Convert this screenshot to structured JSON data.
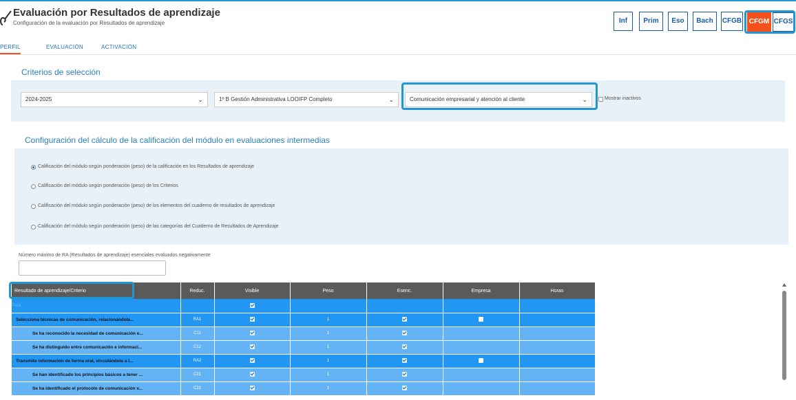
{
  "header": {
    "title": "Evaluación por Resultados de aprendizaje",
    "subtitle": "Configuración de la evaluación por Resultados de aprendizaje",
    "stages": [
      {
        "label": "Inf",
        "active": false
      },
      {
        "label": "Prim",
        "active": false
      },
      {
        "label": "Eso",
        "active": false
      },
      {
        "label": "Bach",
        "active": false
      },
      {
        "label": "CFGB",
        "active": false
      },
      {
        "label": "CFGM",
        "active": true
      },
      {
        "label": "CFGS",
        "active": false
      }
    ]
  },
  "tabs": [
    "PERFIL",
    "EVALUACIÓN",
    "ACTIVACIÓN"
  ],
  "criteria": {
    "title": "Criterios de selección",
    "year": "2024-2025",
    "group": "1º B Gestión Administrativa LOOIFP Completo",
    "module": "Comunicación empresarial y atención al cliente",
    "show_inactive_label": "Mostrar inactivos"
  },
  "config": {
    "title": "Configuración del cálculo de la calificación del módulo en evaluaciones intermedias",
    "options": [
      {
        "label": "Calificación del módulo según ponderación (peso) de la calificación en los Resultados de aprendizaje",
        "checked": true
      },
      {
        "label": "Calificación del módulo según ponderación (peso) de los Criterios",
        "checked": false
      },
      {
        "label": "Calificación del módulo según ponderación (peso) de los elementos del cuaderno de resultados de aprendizaje",
        "checked": false
      },
      {
        "label": "Calificación del módulo según ponderación (peso) de las categorías del Cuaderno de Resultados de Aprendizaje",
        "checked": false
      }
    ],
    "max_negative_label": "Número máximo de RA (Resultados de aprendizaje) esenciales evaluados negativamente",
    "max_negative_value": ""
  },
  "table": {
    "headers": [
      "Resultado de aprendizaje/Criterio",
      "Reduc.",
      "Visible",
      "Peso",
      "Esenc.",
      "Empresa",
      "Horas"
    ],
    "rows": [
      {
        "type": "total",
        "name": "Total",
        "reduc": "",
        "visible": true,
        "peso": "",
        "esenc": null,
        "empresa": null,
        "horas": ""
      },
      {
        "type": "ra",
        "name": "Selecciona técnicas de comunicación, relacionándola...",
        "reduc": "RA1",
        "visible": true,
        "peso": "1",
        "esenc": true,
        "empresa": false,
        "horas": ""
      },
      {
        "type": "ce",
        "name": "Se ha reconocido la necesidad de comunicación e...",
        "reduc": "C11",
        "visible": true,
        "peso": "1",
        "esenc": true,
        "empresa": null,
        "horas": ""
      },
      {
        "type": "ce",
        "name": "Se ha distinguido entre comunicación e informaci...",
        "reduc": "C12",
        "visible": true,
        "peso": "1",
        "esenc": true,
        "empresa": null,
        "horas": ""
      },
      {
        "type": "ra",
        "name": "Transmite información de forma oral, vinculándola a l...",
        "reduc": "RA2",
        "visible": true,
        "peso": "1",
        "esenc": true,
        "empresa": false,
        "horas": ""
      },
      {
        "type": "ce",
        "name": "Se han identificado los principios básicos a tener ...",
        "reduc": "C21",
        "visible": true,
        "peso": "1",
        "esenc": true,
        "empresa": null,
        "horas": ""
      },
      {
        "type": "ce",
        "name": "Se ha identificado el protocolo de comunicación v...",
        "reduc": "C22",
        "visible": true,
        "peso": "1",
        "esenc": true,
        "empresa": null,
        "horas": ""
      }
    ]
  }
}
